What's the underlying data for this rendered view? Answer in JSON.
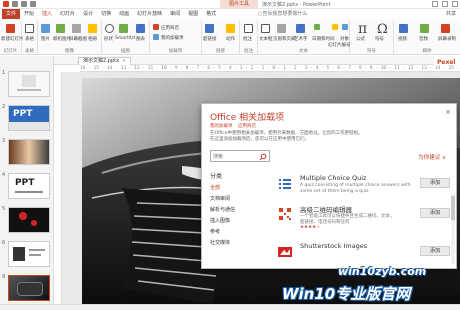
{
  "window": {
    "title": "演示文稿2.pptx - PowerPoint",
    "picture_tools": "图片工具"
  },
  "tabs": [
    "文件",
    "开始",
    "插入",
    "幻灯片",
    "设计",
    "切换",
    "动画",
    "幻灯片放映",
    "审阅",
    "视图",
    "格式"
  ],
  "active_tab": "插入",
  "tell_me": "告诉我您想要做什么",
  "share": "共享",
  "ribbon": {
    "groups": [
      "幻灯片",
      "表格",
      "图像",
      "插图",
      "加载项",
      "链接",
      "批注",
      "文本",
      "符号",
      "媒体"
    ],
    "items": {
      "new_slide": "新建幻灯片",
      "table": "表格",
      "pictures": "图片",
      "online_pictures": "联机图片",
      "screenshot": "屏幕截图",
      "album": "相册",
      "shapes": "形状",
      "smartart": "SmartArt",
      "chart": "图表",
      "store": "应用商店",
      "my_addins": "我的加载项",
      "hyperlink": "超链接",
      "action": "动作",
      "comment": "批注",
      "textbox": "文本框",
      "header_footer": "页眉和页脚",
      "wordart": "艺术字",
      "datetime": "日期和时间",
      "slide_number": "幻灯片编号",
      "object": "对象",
      "equation": "公式",
      "symbol": "符号",
      "video": "视频",
      "audio": "音频",
      "screen_recording": "屏幕录制"
    },
    "pi_glyph": "π",
    "omega_glyph": "Ω"
  },
  "slides": [
    {
      "num": "1",
      "text": ""
    },
    {
      "num": "2",
      "text": "PPT"
    },
    {
      "num": "3",
      "text": ""
    },
    {
      "num": "4",
      "text": "PPT"
    },
    {
      "num": "5",
      "text": ""
    },
    {
      "num": "6",
      "text": ""
    },
    {
      "num": "7",
      "text": ""
    },
    {
      "num": "8",
      "text": ""
    },
    {
      "num": "9",
      "text": ""
    }
  ],
  "selected_slide": "9",
  "doc_tab": {
    "name": "演示文稿2.pptx",
    "close": "×"
  },
  "ruler_text": "16 · 15 · 14 · 13 · 12 · 11 · 10 · 9 · 8 · 7 · 6 · 5 · 4 · 3 · 2 · 1 · 0 · 1 · 2 · 3 · 4 · 5 · 6 · 7 · 8 · 9 · 10 · 11 · 12 · 13 · 14 · 15 · 16",
  "right_label": "Pexel",
  "dialog": {
    "title": "Office 相关加载项",
    "close": "×",
    "my_addins": "我的加载项",
    "store": "应用商店",
    "desc": "在Office中使用相关加载项，使用外来数据、方面地址，让您的工作更轻松。",
    "desc2": "在这里添加加载项后，您可以在应用中使用它们。",
    "search_placeholder": "搜索",
    "suggest": "为你建议 ∨",
    "category_heading": "分类",
    "categories": [
      "全部",
      "文档审阅",
      "解析与通信",
      "插入图像",
      "参考",
      "社交媒体"
    ],
    "selected_category": "全部",
    "addins": [
      {
        "name": "Multiple Choice Quiz",
        "desc": "A quiz consisting of multiple choice answers with",
        "desc2": "some set of them being a quiz",
        "stars": "",
        "button": "添加"
      },
      {
        "name": "高级二维码编辑器",
        "desc": "一个智能工具可以快捷并且生成二维码，文本，",
        "desc2": "超链接、电话号码和任何",
        "stars": "★★★★☆",
        "button": "添加"
      },
      {
        "name": "Shutterstock Images",
        "desc": "",
        "desc2": "",
        "stars": "",
        "button": "添加"
      }
    ]
  },
  "watermark": {
    "line1": "win10zyb.com",
    "line2": "Win10专业版官网"
  },
  "colors": {
    "accent": "#c0412a",
    "watermark_blue": "#1a5fa8"
  }
}
